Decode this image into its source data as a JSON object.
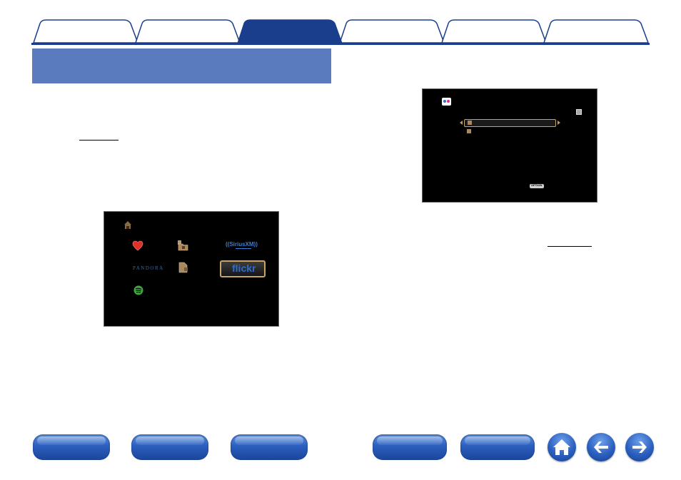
{
  "tabs": [
    {
      "id": "tab-1",
      "active": false
    },
    {
      "id": "tab-2",
      "active": false
    },
    {
      "id": "tab-3",
      "active": true
    },
    {
      "id": "tab-4",
      "active": false
    },
    {
      "id": "tab-5",
      "active": false
    },
    {
      "id": "tab-6",
      "active": false
    }
  ],
  "colors": {
    "accent": "#1a3e8c",
    "section_header": "#5b7bbf",
    "screen_bg": "#000000",
    "highlight_border": "#c8a46a"
  },
  "menu_screen": {
    "icons": [
      "home-icon",
      "favorites-heart-icon",
      "media-server-folder-icon",
      "siriusxm-logo",
      "pandora-logo",
      "usb-folder-icon",
      "flickr-logo",
      "spotify-logo"
    ],
    "pandora_text": "PANDORA",
    "siriusxm_text": "((SiriusXM))",
    "flickr_text": "flickr"
  },
  "flickr_screen": {
    "icons": [
      "flickr-small-icon",
      "folder-icon",
      "folder-icon",
      "options-button"
    ],
    "options_label": "OPTION"
  },
  "bottom_nav": {
    "left_buttons": [
      "nav-button-1",
      "nav-button-2",
      "nav-button-3"
    ],
    "right_buttons": [
      "nav-button-4",
      "nav-button-5"
    ],
    "icons": [
      "home-icon",
      "back-arrow-icon",
      "forward-arrow-icon"
    ]
  }
}
